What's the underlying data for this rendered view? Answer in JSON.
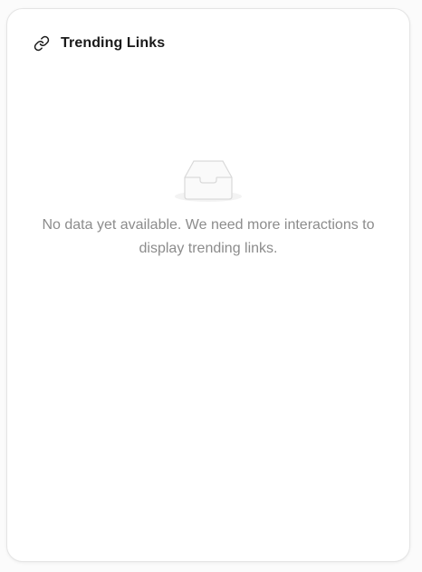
{
  "card": {
    "title": "Trending Links",
    "title_icon": "link-icon",
    "empty_icon": "empty-inbox-icon",
    "empty_message": "No data yet available. We need more interactions to display trending links."
  },
  "colors": {
    "title": "#1a1a1a",
    "empty_text": "#8c8c8c",
    "card_border": "#e4e4e4",
    "background": "#fbfbfb"
  }
}
